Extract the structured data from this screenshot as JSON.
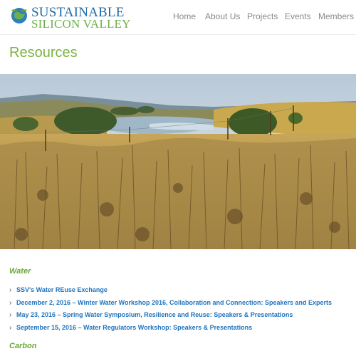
{
  "brand": {
    "line1": "SUSTAINABLE",
    "line2": "SILICON VALLEY"
  },
  "nav": [
    {
      "label": "Home"
    },
    {
      "label": "About Us"
    },
    {
      "label": "Projects"
    },
    {
      "label": "Events"
    },
    {
      "label": "Members"
    }
  ],
  "page": {
    "title": "Resources"
  },
  "hero": {
    "icon": "landscape-photo"
  },
  "sections": [
    {
      "heading": "Water",
      "links": [
        {
          "label": "SSV's Water REuse Exchange"
        },
        {
          "label": "December 2, 2016 – Winter Water Workshop 2016, Collaboration and Connection: Speakers and Experts"
        },
        {
          "label": "May 23, 2016 – Spring Water Symposium, Resilience and Reuse: Speakers & Presentations"
        },
        {
          "label": "September 15, 2016 – Water Regulators Workshop: Speakers & Presentations"
        }
      ]
    },
    {
      "heading": "Carbon",
      "links": []
    }
  ],
  "colors": {
    "brand_blue": "#1f6aa6",
    "brand_green": "#6db14a",
    "title_green": "#7cb342",
    "link_blue": "#1e73be",
    "nav_gray": "#8a8a8a"
  }
}
